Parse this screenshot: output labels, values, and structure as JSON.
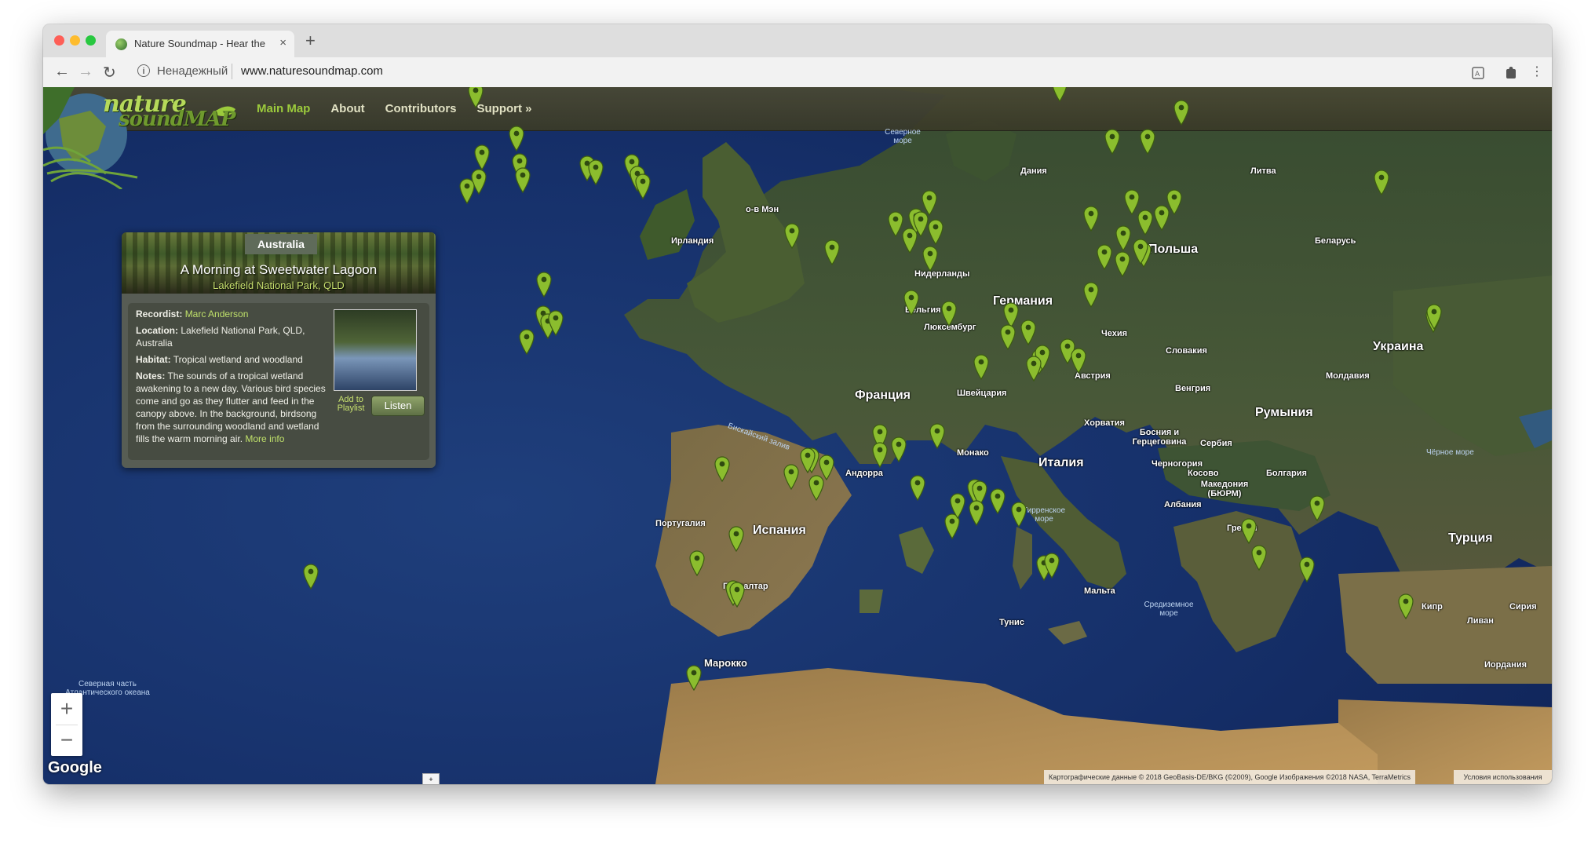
{
  "browser": {
    "tab_title": "Nature Soundmap - Hear the w",
    "tab_close": "×",
    "new_tab": "+",
    "url_status": "Ненадежный",
    "url": "www.naturesoundmap.com",
    "traffic_lights": {
      "close": "#fe5f57",
      "minimize": "#febc2e",
      "zoom": "#28c840"
    }
  },
  "site": {
    "logo_line1": "nature",
    "logo_line2": "soundMAP",
    "nav": [
      "Main Map",
      "About",
      "Contributors",
      "Support »"
    ],
    "active_nav": "Main Map",
    "accent_color": "#9ccb3c"
  },
  "info": {
    "country": "Australia",
    "title": "A Morning at Sweetwater Lagoon",
    "subtitle": "Lakefield National Park, QLD",
    "recordist_label": "Recordist:",
    "recordist": "Marc Anderson",
    "location_label": "Location:",
    "location": "Lakefield National Park, QLD, Australia",
    "habitat_label": "Habitat:",
    "habitat": "Tropical wetland and woodland",
    "notes_label": "Notes:",
    "notes": "The sounds of a tropical wetland awakening to a new day. Various bird species come and go as they flutter and feed in the canopy above. In the background, birdsong from the surrounding woodland and wetland fills the warm morning air.",
    "more_info": "More info",
    "add_playlist": "Add to Playlist",
    "listen": "Listen"
  },
  "map": {
    "zoom_in": "+",
    "zoom_out": "−",
    "google": "Google",
    "attribution": "Картографические данные © 2018 GeoBasis-DE/BKG (©2009), Google Изображения ©2018 NASA, TerraMetrics",
    "terms": "Условия использования",
    "scroll_handle": "+",
    "labels": {
      "north_sea": "Северное море",
      "denmark": "Дания",
      "lithuania": "Литва",
      "isle_of_man": "о-в Мэн",
      "ireland": "Ирландия",
      "poland": "Польша",
      "belarus": "Беларусь",
      "netherlands": "Нидерланды",
      "germany": "Германия",
      "belgium": "Бельгия",
      "luxembourg": "Люксембург",
      "czechia": "Чехия",
      "slovakia": "Словакия",
      "ukraine": "Украина",
      "moldova": "Молдавия",
      "france": "Франция",
      "austria": "Австрия",
      "switzerland": "Швейцария",
      "hungary": "Венгрия",
      "romania": "Румыния",
      "bay_of_biscay": "Бискайский залив",
      "croatia": "Хорватия",
      "bosnia": "Босния и Герцеговина",
      "serbia": "Сербия",
      "monaco": "Монако",
      "andorra": "Андорра",
      "italy": "Италия",
      "montenegro": "Черногория",
      "kosovo": "Косово",
      "bulgaria": "Болгария",
      "black_sea": "Чёрное море",
      "macedonia": "Македония (БЮРМ)",
      "portugal": "Португалия",
      "spain": "Испания",
      "tyrrhenian": "Тирренское море",
      "albania": "Албания",
      "greece": "Греция",
      "turkey": "Турция",
      "north_atlantic": "Северная часть Атлантического океана",
      "gibraltar": "Гибралтар",
      "malta": "Мальта",
      "mediterranean": "Средиземное море",
      "tunisia": "Тунис",
      "cyprus": "Кипр",
      "syria": "Сирия",
      "lebanon": "Ливан",
      "morocco": "Марокко",
      "jordan": "Иордания"
    }
  }
}
